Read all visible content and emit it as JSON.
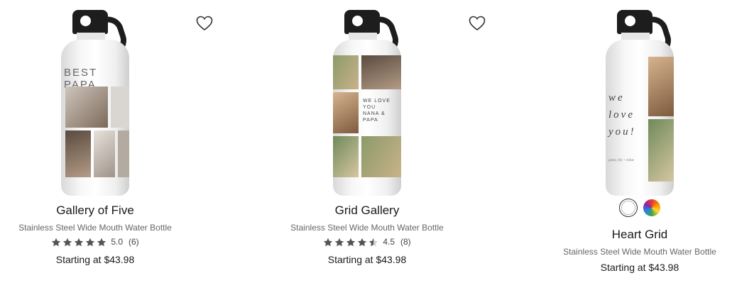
{
  "products": [
    {
      "name": "Gallery of Five",
      "subtitle": "Stainless Steel Wide Mouth Water Bottle",
      "rating": "5.0",
      "rating_value": 5.0,
      "reviews": "(6)",
      "price": "Starting at $43.98",
      "bottle_text": "BEST PAPA"
    },
    {
      "name": "Grid Gallery",
      "subtitle": "Stainless Steel Wide Mouth Water Bottle",
      "rating": "4.5",
      "rating_value": 4.5,
      "reviews": "(8)",
      "price": "Starting at $43.98",
      "bottle_text": "WE LOVE YOU NANA & PAPA"
    },
    {
      "name": "Heart Grid",
      "subtitle": "Stainless Steel Wide Mouth Water Bottle",
      "price": "Starting at $43.98",
      "bottle_text": "we love you!",
      "bottle_signature": "jason, lily + chloe",
      "swatches": [
        "white",
        "multicolor"
      ]
    }
  ],
  "colors": {
    "star": "#555555",
    "heart_stroke": "#333333",
    "cap": "#1d1d1d"
  },
  "icons": {
    "favorite": "heart-outline-icon",
    "star": "star-icon"
  }
}
